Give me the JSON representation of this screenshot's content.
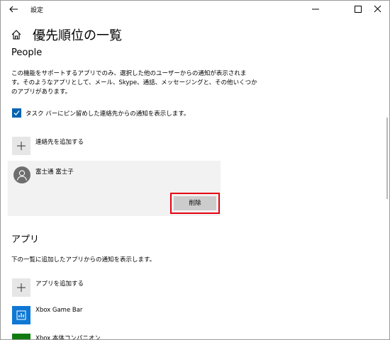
{
  "window": {
    "title": "設定",
    "back_icon": "back-arrow-icon",
    "controls": [
      "minimize-icon",
      "maximize-icon",
      "close-icon"
    ]
  },
  "header": {
    "home_icon": "home-icon",
    "title": "優先順位の一覧"
  },
  "people": {
    "heading": "People",
    "description_lines": [
      "この機能をサポートするアプリでのみ、選択した他のユーザーからの通知が表示されま",
      "す。そのようなアプリとして、メール、Skype、通話、メッセージングと、その他いくつか",
      "のアプリがあります。"
    ],
    "checkbox": {
      "checked": true,
      "label": "タスク バーにピン留めした連絡先からの通知を表示します。"
    },
    "add_contact_label": "連絡先を追加する",
    "contacts": [
      {
        "name": "富士通 富士子",
        "remove_label": "削除"
      }
    ]
  },
  "apps": {
    "heading": "アプリ",
    "description": "下の一覧に追加したアプリからの通知を表示します。",
    "add_app_label": "アプリを追加する",
    "items": [
      {
        "label": "Xbox Game Bar",
        "icon": "xbox-game-bar-icon",
        "color": "#0f78d4"
      },
      {
        "label": "Xbox 本体コンパニオン",
        "icon": "xbox-companion-icon",
        "color": "#107c10"
      }
    ]
  },
  "colors": {
    "accent": "#0063b1",
    "highlight_border": "#e60012"
  }
}
